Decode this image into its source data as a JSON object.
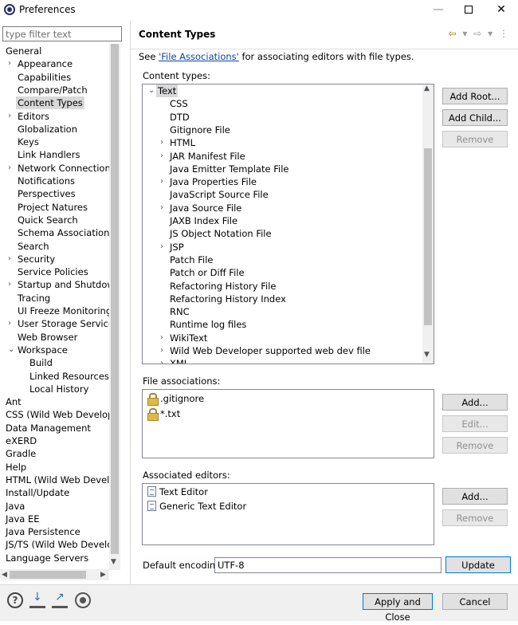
{
  "window": {
    "title": "Preferences",
    "minimize": "—",
    "close": "✕"
  },
  "filter": {
    "placeholder": "type filter text"
  },
  "nav": [
    {
      "label": "General",
      "level": 0,
      "twisty": "▾"
    },
    {
      "label": "Appearance",
      "level": 1,
      "twisty": "›"
    },
    {
      "label": "Capabilities",
      "level": 1,
      "twisty": ""
    },
    {
      "label": "Compare/Patch",
      "level": 1,
      "twisty": ""
    },
    {
      "label": "Content Types",
      "level": 1,
      "twisty": "",
      "selected": true
    },
    {
      "label": "Editors",
      "level": 1,
      "twisty": "›"
    },
    {
      "label": "Globalization",
      "level": 1,
      "twisty": ""
    },
    {
      "label": "Keys",
      "level": 1,
      "twisty": ""
    },
    {
      "label": "Link Handlers",
      "level": 1,
      "twisty": ""
    },
    {
      "label": "Network Connections",
      "level": 1,
      "twisty": "›"
    },
    {
      "label": "Notifications",
      "level": 1,
      "twisty": ""
    },
    {
      "label": "Perspectives",
      "level": 1,
      "twisty": ""
    },
    {
      "label": "Project Natures",
      "level": 1,
      "twisty": ""
    },
    {
      "label": "Quick Search",
      "level": 1,
      "twisty": ""
    },
    {
      "label": "Schema Associations",
      "level": 1,
      "twisty": ""
    },
    {
      "label": "Search",
      "level": 1,
      "twisty": ""
    },
    {
      "label": "Security",
      "level": 1,
      "twisty": "›"
    },
    {
      "label": "Service Policies",
      "level": 1,
      "twisty": ""
    },
    {
      "label": "Startup and Shutdown",
      "level": 1,
      "twisty": "›"
    },
    {
      "label": "Tracing",
      "level": 1,
      "twisty": ""
    },
    {
      "label": "UI Freeze Monitoring",
      "level": 1,
      "twisty": ""
    },
    {
      "label": "User Storage Service",
      "level": 1,
      "twisty": "›"
    },
    {
      "label": "Web Browser",
      "level": 1,
      "twisty": ""
    },
    {
      "label": "Workspace",
      "level": 1,
      "twisty": "⌄"
    },
    {
      "label": "Build",
      "level": 2,
      "twisty": ""
    },
    {
      "label": "Linked Resources",
      "level": 2,
      "twisty": ""
    },
    {
      "label": "Local History",
      "level": 2,
      "twisty": ""
    },
    {
      "label": "Ant",
      "level": 0,
      "twisty": ""
    },
    {
      "label": "CSS (Wild Web Developer)",
      "level": 0,
      "twisty": ""
    },
    {
      "label": "Data Management",
      "level": 0,
      "twisty": ""
    },
    {
      "label": "eXERD",
      "level": 0,
      "twisty": ""
    },
    {
      "label": "Gradle",
      "level": 0,
      "twisty": ""
    },
    {
      "label": "Help",
      "level": 0,
      "twisty": ""
    },
    {
      "label": "HTML (Wild Web Developer)",
      "level": 0,
      "twisty": ""
    },
    {
      "label": "Install/Update",
      "level": 0,
      "twisty": ""
    },
    {
      "label": "Java",
      "level": 0,
      "twisty": ""
    },
    {
      "label": "Java EE",
      "level": 0,
      "twisty": ""
    },
    {
      "label": "Java Persistence",
      "level": 0,
      "twisty": ""
    },
    {
      "label": "JS/TS (Wild Web Developer)",
      "level": 0,
      "twisty": ""
    },
    {
      "label": "Language Servers",
      "level": 0,
      "twisty": ""
    }
  ],
  "page": {
    "title": "Content Types",
    "nav_back": "⇦",
    "nav_forward": "⇨",
    "nav_dropdown": "▾",
    "menu": "⋮",
    "desc_before": "See ",
    "desc_link": "'File Associations'",
    "desc_after": " for associating editors with file types."
  },
  "content_types": {
    "label": "Content types:",
    "items": [
      {
        "label": "Text",
        "level": 0,
        "twisty": "⌄",
        "selected": true
      },
      {
        "label": "CSS",
        "level": 1,
        "twisty": ""
      },
      {
        "label": "DTD",
        "level": 1,
        "twisty": ""
      },
      {
        "label": "Gitignore File",
        "level": 1,
        "twisty": ""
      },
      {
        "label": "HTML",
        "level": 1,
        "twisty": "›"
      },
      {
        "label": "JAR Manifest File",
        "level": 1,
        "twisty": "›"
      },
      {
        "label": "Java Emitter Template File",
        "level": 1,
        "twisty": ""
      },
      {
        "label": "Java Properties File",
        "level": 1,
        "twisty": "›"
      },
      {
        "label": "JavaScript Source File",
        "level": 1,
        "twisty": ""
      },
      {
        "label": "Java Source File",
        "level": 1,
        "twisty": "›"
      },
      {
        "label": "JAXB Index File",
        "level": 1,
        "twisty": ""
      },
      {
        "label": "JS Object Notation File",
        "level": 1,
        "twisty": ""
      },
      {
        "label": "JSP",
        "level": 1,
        "twisty": "›"
      },
      {
        "label": "Patch File",
        "level": 1,
        "twisty": ""
      },
      {
        "label": "Patch or Diff File",
        "level": 1,
        "twisty": ""
      },
      {
        "label": "Refactoring History File",
        "level": 1,
        "twisty": ""
      },
      {
        "label": "Refactoring History Index",
        "level": 1,
        "twisty": ""
      },
      {
        "label": "RNC",
        "level": 1,
        "twisty": ""
      },
      {
        "label": "Runtime log files",
        "level": 1,
        "twisty": ""
      },
      {
        "label": "WikiText",
        "level": 1,
        "twisty": "›"
      },
      {
        "label": "Wild Web Developer supported web dev file",
        "level": 1,
        "twisty": "›"
      },
      {
        "label": "XML",
        "level": 1,
        "twisty": "›"
      }
    ],
    "add_root": "Add Root...",
    "add_child": "Add Child...",
    "remove": "Remove"
  },
  "file_associations": {
    "label": "File associations:",
    "items": [
      ".gitignore",
      "*.txt"
    ],
    "add": "Add...",
    "edit": "Edit...",
    "remove": "Remove"
  },
  "associated_editors": {
    "label": "Associated editors:",
    "items": [
      "Text Editor",
      "Generic Text Editor"
    ],
    "add": "Add...",
    "remove": "Remove"
  },
  "encoding": {
    "label": "Default encoding:",
    "value": "UTF-8",
    "update": "Update"
  },
  "footer": {
    "apply_close": "Apply and Close",
    "cancel": "Cancel",
    "help": "?"
  },
  "scroll": {
    "up": "▲",
    "down": "▼",
    "left": "◀",
    "right": "▶"
  }
}
